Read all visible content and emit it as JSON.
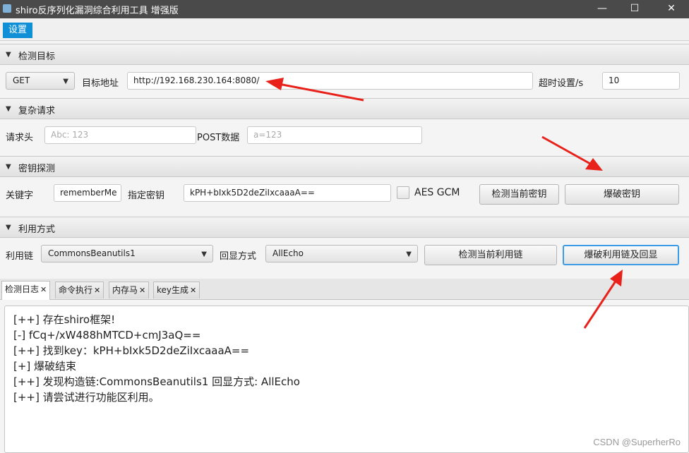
{
  "window": {
    "title": "shiro反序列化漏洞综合利用工具 增强版",
    "minimize_glyph": "—",
    "maximize_glyph": "☐",
    "close_glyph": "✕"
  },
  "menu": {
    "settings_label": "设置"
  },
  "sections": {
    "target": {
      "header": "检测目标",
      "method": "GET",
      "url_label": "目标地址",
      "url_value": "http://192.168.230.164:8080/",
      "timeout_label": "超时设置/s",
      "timeout_value": "10"
    },
    "complex": {
      "header": "复杂请求",
      "headers_label": "请求头",
      "headers_placeholder": "Abc: 123",
      "post_label": "POST数据",
      "post_placeholder": "a=123"
    },
    "key": {
      "header": "密钥探测",
      "keyword_label": "关键字",
      "keyword_value": "rememberMe",
      "key_label": "指定密钥",
      "key_value": "kPH+bIxk5D2deZiIxcaaaA==",
      "aes_gcm_label": "AES GCM",
      "aes_gcm_checked": false,
      "check_key_button": "检测当前密钥",
      "brute_key_button": "爆破密钥"
    },
    "exploit": {
      "header": "利用方式",
      "chain_label": "利用链",
      "chain_value": "CommonsBeanutils1",
      "echo_label": "回显方式",
      "echo_value": "AllEcho",
      "check_chain_button": "检测当前利用链",
      "brute_chain_button": "爆破利用链及回显"
    }
  },
  "tabs": [
    {
      "label": "检测日志",
      "active": true
    },
    {
      "label": "命令执行",
      "active": false
    },
    {
      "label": "内存马",
      "active": false
    },
    {
      "label": "key生成",
      "active": false
    }
  ],
  "console_lines": [
    "[++] 存在shiro框架!",
    "[-] fCq+/xW488hMTCD+cmJ3aQ==",
    "[++] 找到key：kPH+bIxk5D2deZiIxcaaaA==",
    "[+] 爆破结束",
    "[++] 发现构造链:CommonsBeanutils1  回显方式: AllEcho",
    "[++] 请尝试进行功能区利用。"
  ],
  "watermark": "CSDN @SuperherRo",
  "colors": {
    "accent": "#0e8fd6",
    "annotation_arrow": "#e8221b"
  }
}
